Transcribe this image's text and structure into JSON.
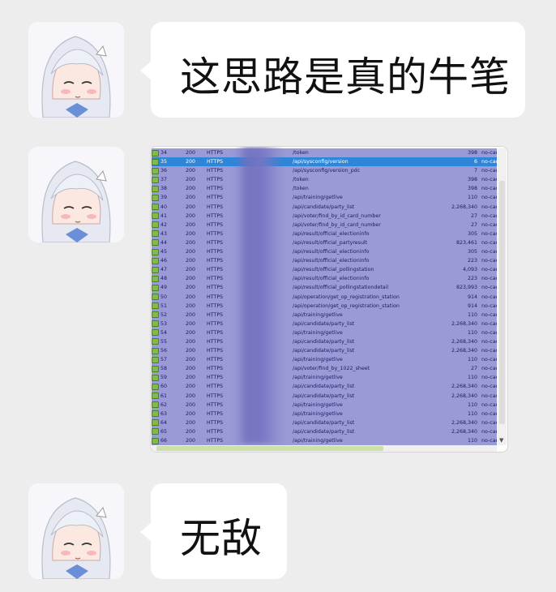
{
  "messages": [
    {
      "text": "这思路是真的牛笔"
    },
    {
      "text": ""
    },
    {
      "text": "无敌"
    }
  ],
  "screenshot": {
    "rows": [
      {
        "num": "34",
        "result": "200",
        "protocol": "HTTPS",
        "url": "/token",
        "body": "398",
        "cache": "no-cac"
      },
      {
        "num": "35",
        "result": "200",
        "protocol": "HTTPS",
        "url": "/api/sysconfig/version",
        "body": "6",
        "cache": "no-cac",
        "selected": true
      },
      {
        "num": "36",
        "result": "200",
        "protocol": "HTTPS",
        "url": "/api/sysconfig/version_pdc",
        "body": "7",
        "cache": "no-cac"
      },
      {
        "num": "37",
        "result": "200",
        "protocol": "HTTPS",
        "url": "/token",
        "body": "398",
        "cache": "no-cac"
      },
      {
        "num": "38",
        "result": "200",
        "protocol": "HTTPS",
        "url": "/token",
        "body": "398",
        "cache": "no-cac"
      },
      {
        "num": "39",
        "result": "200",
        "protocol": "HTTPS",
        "url": "/api/training/getlive",
        "body": "110",
        "cache": "no-cac"
      },
      {
        "num": "40",
        "result": "200",
        "protocol": "HTTPS",
        "url": "/api/candidate/party_list",
        "body": "2,268,340",
        "cache": "no-cac"
      },
      {
        "num": "41",
        "result": "200",
        "protocol": "HTTPS",
        "url": "/api/voter/find_by_id_card_number",
        "body": "27",
        "cache": "no-cac"
      },
      {
        "num": "42",
        "result": "200",
        "protocol": "HTTPS",
        "url": "/api/voter/find_by_id_card_number",
        "body": "27",
        "cache": "no-cac"
      },
      {
        "num": "43",
        "result": "200",
        "protocol": "HTTPS",
        "url": "/api/result/official_electioninfo",
        "body": "305",
        "cache": "no-cac"
      },
      {
        "num": "44",
        "result": "200",
        "protocol": "HTTPS",
        "url": "/api/result/official_partyresult",
        "body": "823,461",
        "cache": "no-cac"
      },
      {
        "num": "45",
        "result": "200",
        "protocol": "HTTPS",
        "url": "/api/result/official_electioninfo",
        "body": "305",
        "cache": "no-cac"
      },
      {
        "num": "46",
        "result": "200",
        "protocol": "HTTPS",
        "url": "/api/result/official_electioninfo",
        "body": "223",
        "cache": "no-cac"
      },
      {
        "num": "47",
        "result": "200",
        "protocol": "HTTPS",
        "url": "/api/result/official_pollingstation",
        "body": "4,093",
        "cache": "no-cac"
      },
      {
        "num": "48",
        "result": "200",
        "protocol": "HTTPS",
        "url": "/api/result/official_electioninfo",
        "body": "223",
        "cache": "no-cac"
      },
      {
        "num": "49",
        "result": "200",
        "protocol": "HTTPS",
        "url": "/api/result/official_pollingstationdetail",
        "body": "823,993",
        "cache": "no-cac"
      },
      {
        "num": "50",
        "result": "200",
        "protocol": "HTTPS",
        "url": "/api/operation/get_op_registration_station",
        "body": "914",
        "cache": "no-cac"
      },
      {
        "num": "51",
        "result": "200",
        "protocol": "HTTPS",
        "url": "/api/operation/get_op_registration_station",
        "body": "914",
        "cache": "no-cac"
      },
      {
        "num": "52",
        "result": "200",
        "protocol": "HTTPS",
        "url": "/api/training/getlive",
        "body": "110",
        "cache": "no-cac"
      },
      {
        "num": "53",
        "result": "200",
        "protocol": "HTTPS",
        "url": "/api/candidate/party_list",
        "body": "2,268,340",
        "cache": "no-cac"
      },
      {
        "num": "54",
        "result": "200",
        "protocol": "HTTPS",
        "url": "/api/training/getlive",
        "body": "110",
        "cache": "no-cac"
      },
      {
        "num": "55",
        "result": "200",
        "protocol": "HTTPS",
        "url": "/api/candidate/party_list",
        "body": "2,268,340",
        "cache": "no-cac"
      },
      {
        "num": "56",
        "result": "200",
        "protocol": "HTTPS",
        "url": "/api/candidate/party_list",
        "body": "2,268,340",
        "cache": "no-cac"
      },
      {
        "num": "57",
        "result": "200",
        "protocol": "HTTPS",
        "url": "/api/training/getlive",
        "body": "110",
        "cache": "no-cac"
      },
      {
        "num": "58",
        "result": "200",
        "protocol": "HTTPS",
        "url": "/api/voter/find_by_1022_sheet",
        "body": "27",
        "cache": "no-cac"
      },
      {
        "num": "59",
        "result": "200",
        "protocol": "HTTPS",
        "url": "/api/training/getlive",
        "body": "110",
        "cache": "no-cac"
      },
      {
        "num": "60",
        "result": "200",
        "protocol": "HTTPS",
        "url": "/api/candidate/party_list",
        "body": "2,268,340",
        "cache": "no-cac"
      },
      {
        "num": "61",
        "result": "200",
        "protocol": "HTTPS",
        "url": "/api/candidate/party_list",
        "body": "2,268,340",
        "cache": "no-cac"
      },
      {
        "num": "62",
        "result": "200",
        "protocol": "HTTPS",
        "url": "/api/training/getlive",
        "body": "110",
        "cache": "no-cac"
      },
      {
        "num": "63",
        "result": "200",
        "protocol": "HTTPS",
        "url": "/api/training/getlive",
        "body": "110",
        "cache": "no-cac"
      },
      {
        "num": "64",
        "result": "200",
        "protocol": "HTTPS",
        "url": "/api/candidate/party_list",
        "body": "2,268,340",
        "cache": "no-cac"
      },
      {
        "num": "65",
        "result": "200",
        "protocol": "HTTPS",
        "url": "/api/candidate/party_list",
        "body": "2,268,340",
        "cache": "no-cac"
      },
      {
        "num": "66",
        "result": "200",
        "protocol": "HTTPS",
        "url": "/api/training/getlive",
        "body": "110",
        "cache": "no-cac"
      }
    ]
  },
  "icons": {
    "avatar": "anime-girl-avatar-icon",
    "session": "session-arrow-icon"
  },
  "colors": {
    "background": "#ededed",
    "bubble": "#ffffff",
    "grid": "#9a9ad7",
    "selected_row": "#2e86d9"
  }
}
